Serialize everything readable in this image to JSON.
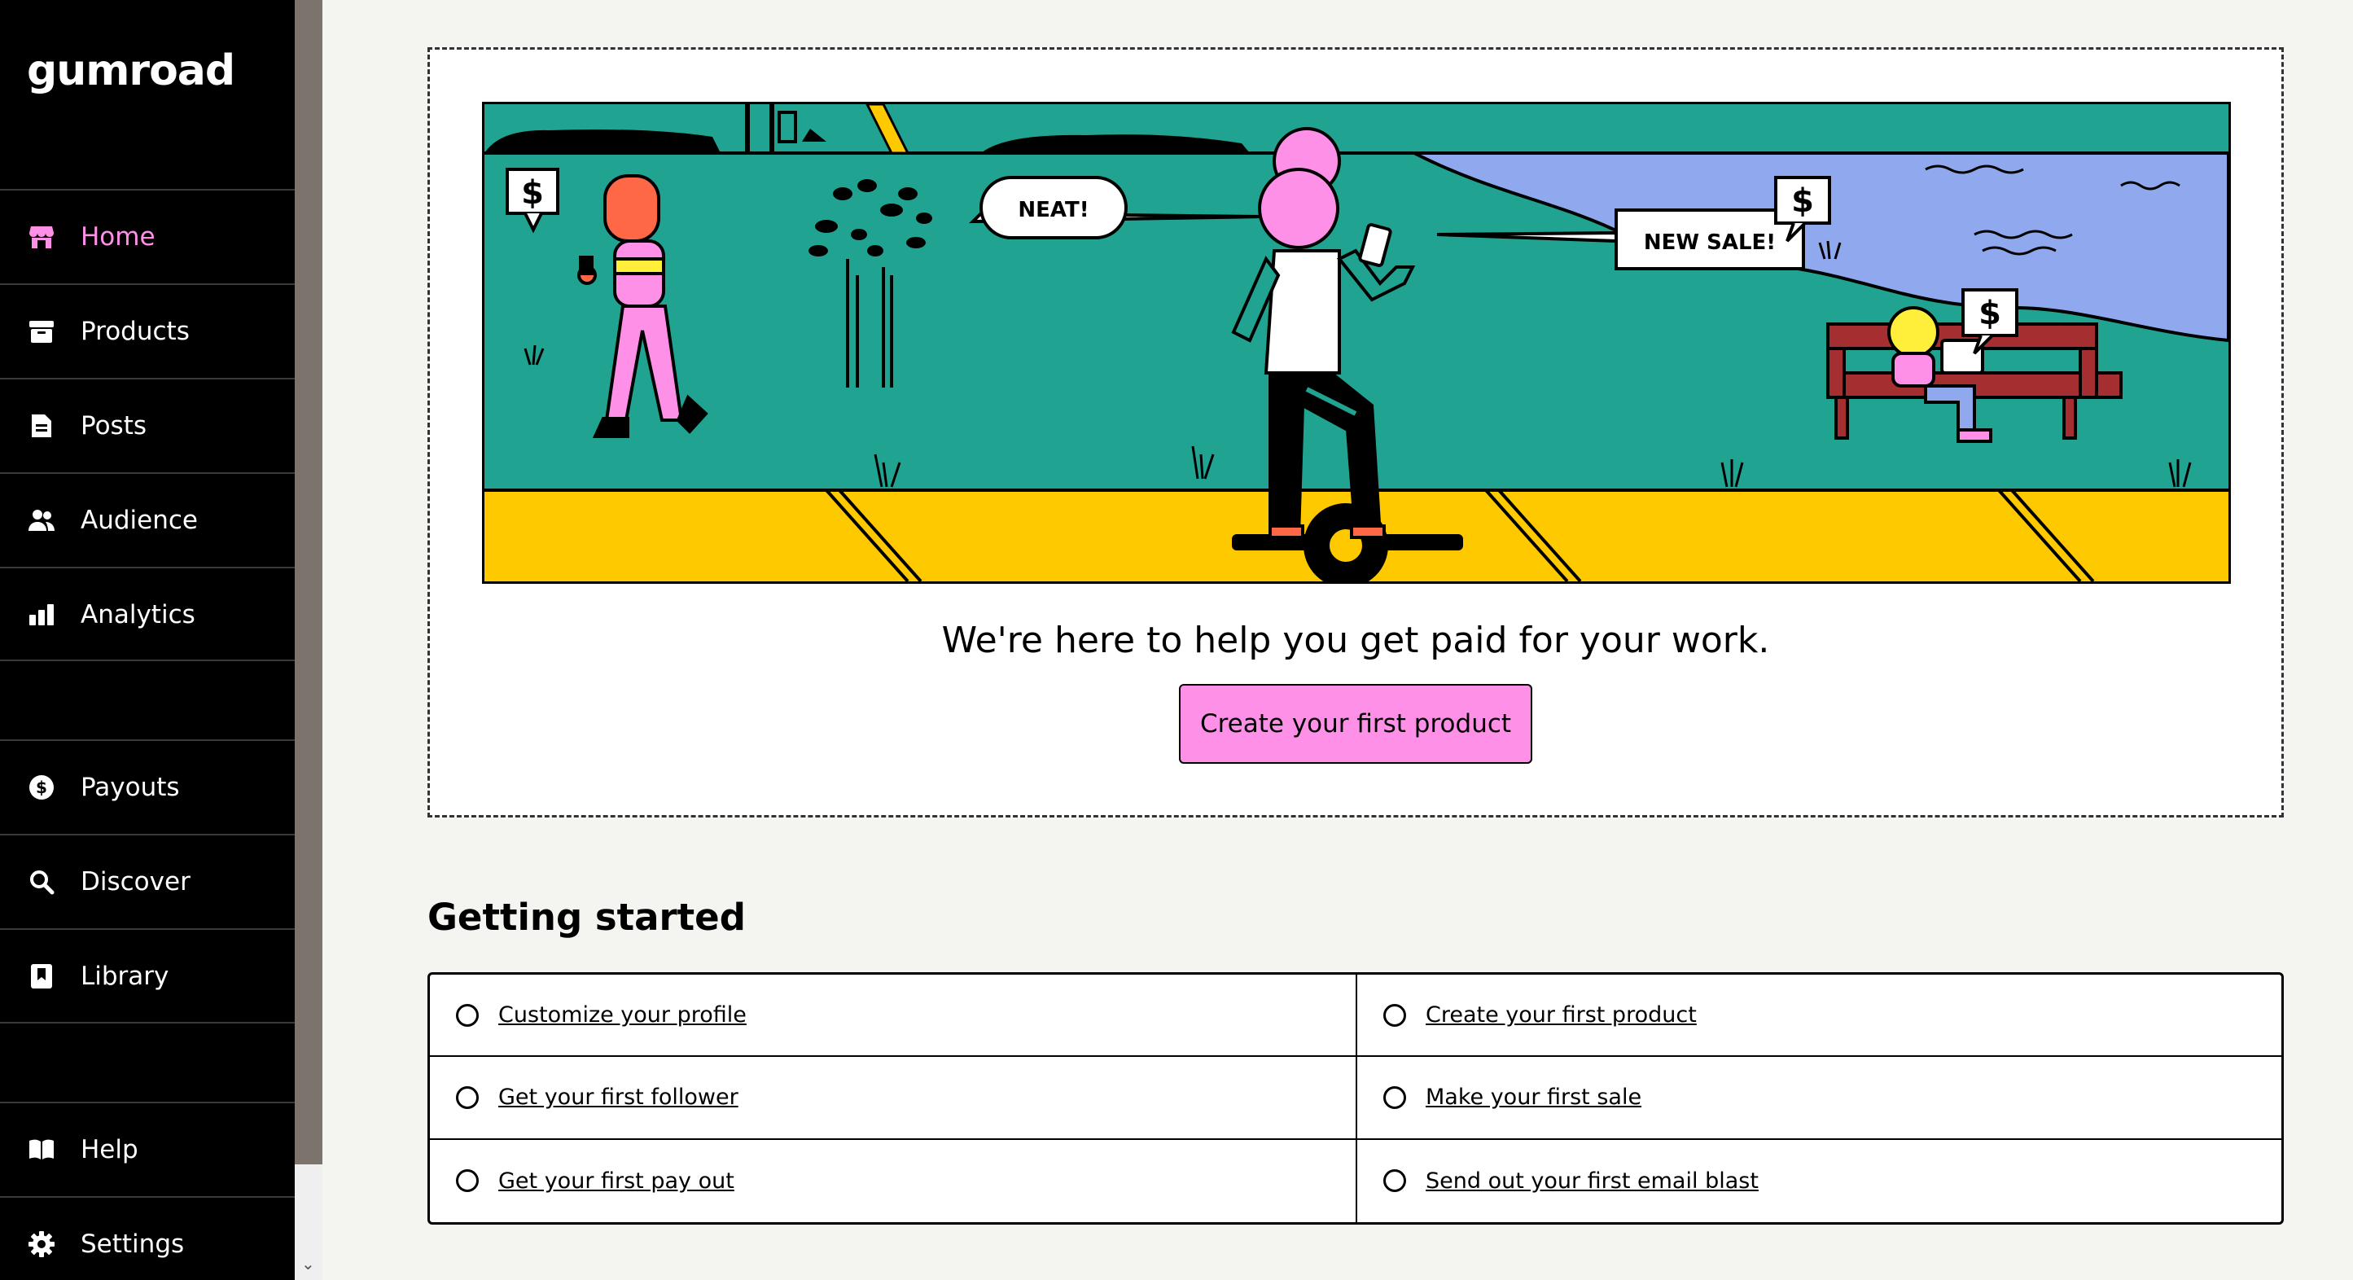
{
  "app": {
    "logo_text": "Gumroad"
  },
  "sidebar": {
    "items": [
      {
        "label": "Home",
        "icon": "store-icon",
        "active": true
      },
      {
        "label": "Products",
        "icon": "archive-icon"
      },
      {
        "label": "Posts",
        "icon": "document-icon"
      },
      {
        "label": "Audience",
        "icon": "people-icon"
      },
      {
        "label": "Analytics",
        "icon": "bar-chart-icon"
      },
      {
        "label": "Payouts",
        "icon": "dollar-circle-icon"
      },
      {
        "label": "Discover",
        "icon": "search-icon"
      },
      {
        "label": "Library",
        "icon": "bookmark-icon"
      },
      {
        "label": "Help",
        "icon": "book-icon"
      },
      {
        "label": "Settings",
        "icon": "gear-icon"
      }
    ]
  },
  "hero": {
    "illustration_texts": {
      "bubble_neat": "NEAT!",
      "bubble_sale": "NEW SALE!",
      "dollar": "$"
    },
    "tagline": "We're here to help you get paid for your work.",
    "cta_label": "Create your first product"
  },
  "getting_started": {
    "title": "Getting started",
    "items": [
      "Customize your profile",
      "Create your first product",
      "Get your first follower",
      "Make your first sale",
      "Get your first pay out",
      "Send out your first email blast"
    ]
  },
  "colors": {
    "accent": "#ff90e8",
    "sidebar_bg": "#000000",
    "page_bg": "#f4f4f0",
    "teal": "#21a392",
    "yellow": "#ffc900",
    "lavender": "#90a8ed"
  }
}
